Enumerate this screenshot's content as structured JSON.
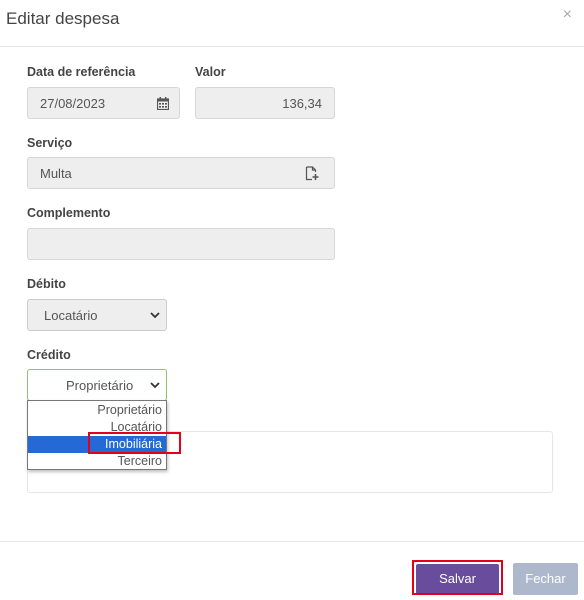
{
  "modal": {
    "title": "Editar despesa",
    "close_glyph": "×"
  },
  "form": {
    "data_ref": {
      "label": "Data de referência",
      "value": "27/08/2023",
      "icon": "calendar-icon"
    },
    "valor": {
      "label": "Valor",
      "value": "136,34"
    },
    "servico": {
      "label": "Serviço",
      "value": "Multa",
      "icon": "file-add-icon"
    },
    "complemento": {
      "label": "Complemento",
      "value": ""
    },
    "debito": {
      "label": "Débito",
      "value": "Locatário"
    },
    "credito": {
      "label": "Crédito",
      "value": "Proprietário",
      "options": [
        "Proprietário",
        "Locatário",
        "Imobiliária",
        "Terceiro"
      ],
      "highlighted": "Imobiliária"
    }
  },
  "footer": {
    "save_label": "Salvar",
    "close_label": "Fechar"
  },
  "colors": {
    "save_button": "#6a4c9c",
    "close_button": "#aeb8cc",
    "selected_option": "#2469d6",
    "annotation": "#e2001a"
  }
}
